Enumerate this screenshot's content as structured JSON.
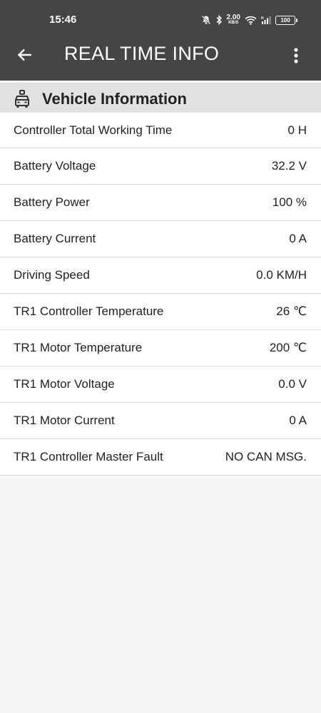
{
  "status_bar": {
    "time": "15:46",
    "net_speed": "2.00",
    "net_unit": "KB/S",
    "battery": "100",
    "icons": [
      "mute-bell-icon",
      "bluetooth-icon",
      "wifi-icon",
      "signal-icon",
      "battery-icon"
    ]
  },
  "app_bar": {
    "title": "REAL TIME INFO",
    "back_icon": "arrow-left-icon",
    "menu_icon": "more-vert-icon"
  },
  "section": {
    "icon": "vehicle-icon",
    "title": "Vehicle Information"
  },
  "rows": [
    {
      "label": "Controller Total Working Time",
      "value": "0 H"
    },
    {
      "label": "Battery Voltage",
      "value": "32.2 V"
    },
    {
      "label": "Battery Power",
      "value": "100 %"
    },
    {
      "label": "Battery Current",
      "value": "0 A"
    },
    {
      "label": "Driving Speed",
      "value": "0.0 KM/H"
    },
    {
      "label": "TR1 Controller Temperature",
      "value": "26 ℃"
    },
    {
      "label": "TR1 Motor Temperature",
      "value": "200 ℃"
    },
    {
      "label": "TR1 Motor Voltage",
      "value": "0.0 V"
    },
    {
      "label": "TR1 Motor Current",
      "value": "0 A"
    },
    {
      "label": "TR1 Controller Master Fault",
      "value": "NO CAN MSG."
    }
  ],
  "colors": {
    "app_bar": "#454545",
    "section_header": "#e2e2e2",
    "background": "#f5f5f5"
  }
}
